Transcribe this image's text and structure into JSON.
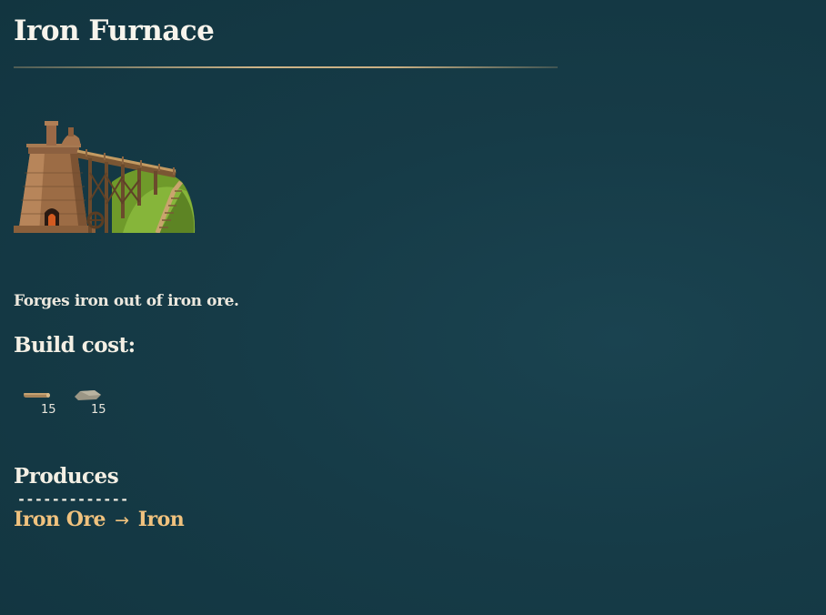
{
  "panel": {
    "title": "Iron Furnace",
    "image_icon": "iron-furnace-building",
    "description": "Forges iron out of iron ore.",
    "build_cost_heading": "Build cost:",
    "build_cost": [
      {
        "icon": "wood-log-icon",
        "quantity": "15"
      },
      {
        "icon": "stone-icon",
        "quantity": "15"
      }
    ],
    "produces_heading": "Produces",
    "separator": "-------------",
    "recipe": {
      "input": "Iron Ore",
      "arrow": "→",
      "output": "Iron"
    }
  },
  "colors": {
    "background": "#163a47",
    "text": "#f3efe4",
    "recipe_text": "#f0c27e",
    "rule": "#cdb488"
  }
}
